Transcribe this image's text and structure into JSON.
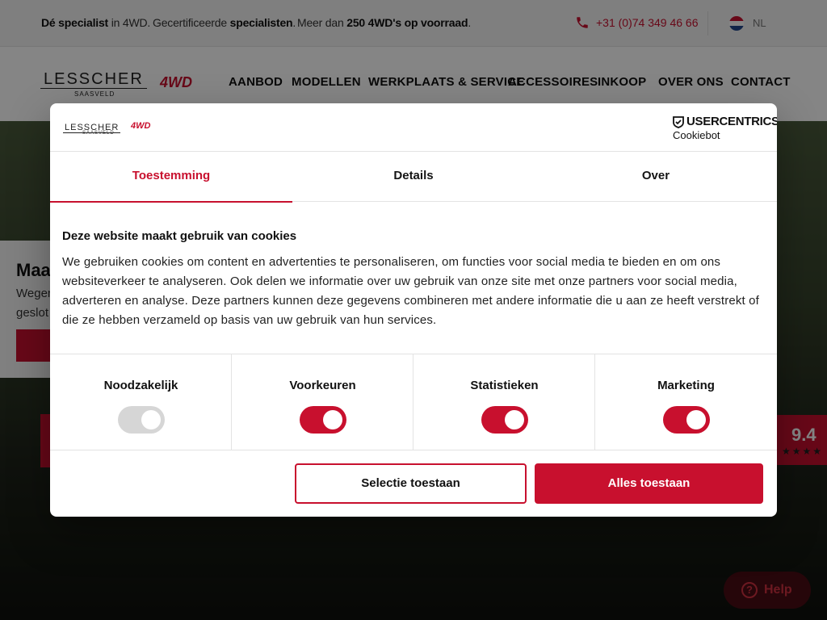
{
  "topbar": {
    "usp1_bold": "Dé specialist",
    "usp1_rest": " in 4WD.",
    "usp2_pre": "Gecertificeerde ",
    "usp2_bold": "specialisten",
    "usp2_post": ".",
    "usp3_pre": "Meer dan ",
    "usp3_bold": "250 4WD's op voorraad",
    "usp3_post": ".",
    "phone": "+31 (0)74 349 46 66",
    "language": "NL"
  },
  "header": {
    "logo_main": "LESSCHER",
    "logo_sub": "SAASVELD",
    "logo_badge": "4WD",
    "nav": [
      "AANBOD",
      "MODELLEN",
      "WERKPLAATS & SERVICE",
      "ACCESSOIRES",
      "INKOOP",
      "OVER ONS",
      "CONTACT"
    ]
  },
  "hero": {
    "title": "Maar",
    "subtitle_line1": "Wegen",
    "subtitle_line2": "geslot"
  },
  "review": {
    "score": "9.4",
    "stars": "★★★★"
  },
  "help": {
    "label": "Help",
    "icon": "?"
  },
  "cookie": {
    "brand": "USERCENTRICS",
    "brand_sub": "Cookiebot",
    "tabs": [
      "Toestemming",
      "Details",
      "Over"
    ],
    "active_tab": 0,
    "title": "Deze website maakt gebruik van cookies",
    "text": "We gebruiken cookies om content en advertenties te personaliseren, om functies voor social media te bieden en om ons websiteverkeer te analyseren. Ook delen we informatie over uw gebruik van onze site met onze partners voor social media, adverteren en analyse. Deze partners kunnen deze gegevens combineren met andere informatie die u aan ze heeft verstrekt of die ze hebben verzameld op basis van uw gebruik van hun services.",
    "categories": [
      {
        "label": "Noodzakelijk",
        "checked": true,
        "disabled": true
      },
      {
        "label": "Voorkeuren",
        "checked": true,
        "disabled": false
      },
      {
        "label": "Statistieken",
        "checked": true,
        "disabled": false
      },
      {
        "label": "Marketing",
        "checked": true,
        "disabled": false
      }
    ],
    "btn_selection": "Selectie toestaan",
    "btn_all": "Alles toestaan"
  },
  "colors": {
    "accent": "#c8102e",
    "toggle_disabled": "#d6d6d6"
  }
}
